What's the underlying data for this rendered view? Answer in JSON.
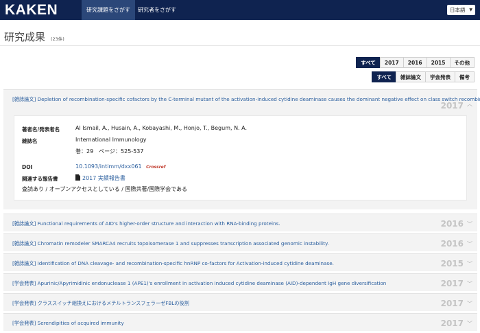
{
  "navbar": {
    "logo": "KAKEN",
    "tabs": [
      "研究課題をさがす",
      "研究者をさがす"
    ],
    "language": "日本語"
  },
  "page": {
    "title": "研究成果",
    "count": "(23件)"
  },
  "year_filter": [
    "すべて",
    "2017",
    "2016",
    "2015",
    "その他"
  ],
  "type_filter": [
    "すべて",
    "雑誌論文",
    "学会発表",
    "備考"
  ],
  "expanded": {
    "label": "[雑誌論文] Depletion of recombination-specific cofactors by the C-terminal mutant of the activation-induced cytidine deaminase causes the dominant negative effect on class switch recombination.",
    "year": "2017",
    "authors_label": "著者名/発表者名",
    "authors": "Al Ismail, A., Husain, A., Kobayashi, M., Honjo, T., Begum, N. A.",
    "journal_label": "雑誌名",
    "journal": "International Immunology",
    "volume": "巻：29　ページ：525-537",
    "doi_label": "DOI",
    "doi": "10.1093/intimm/dxx061",
    "crossref": "Crossref",
    "report_label": "関連する報告書",
    "report": "2017 実績報告書",
    "notes": "査読あり / オープンアクセスとしている / 国際共著/国際学会である"
  },
  "items": [
    {
      "label": "[雑誌論文] Functional requirements of AID's higher-order structure and interaction with RNA-binding proteins.",
      "year": "2016"
    },
    {
      "label": "[雑誌論文] Chromatin remodeler SMARCA4 recruits topoisomerase 1 and suppresses transcription associated genomic instability.",
      "year": "2016"
    },
    {
      "label": "[雑誌論文] Identification of DNA cleavage- and recombination-specific hnRNP co-factors for Activation-induced cytidine deaminase.",
      "year": "2015"
    },
    {
      "label": "[学会発表] Apurinic/Apyrimidinic endonuclease 1 (APE1)'s enrollment in activation induced cytidine deaminase (AID)-dependent IgH gene diversification",
      "year": "2017"
    },
    {
      "label": "[学会発表] クラススイッチ組換えにおけるメチルトランスフェラーゼFBLの役割",
      "year": "2017"
    },
    {
      "label": "[学会発表] Serendipities of acquired immunity",
      "year": "2017"
    }
  ]
}
